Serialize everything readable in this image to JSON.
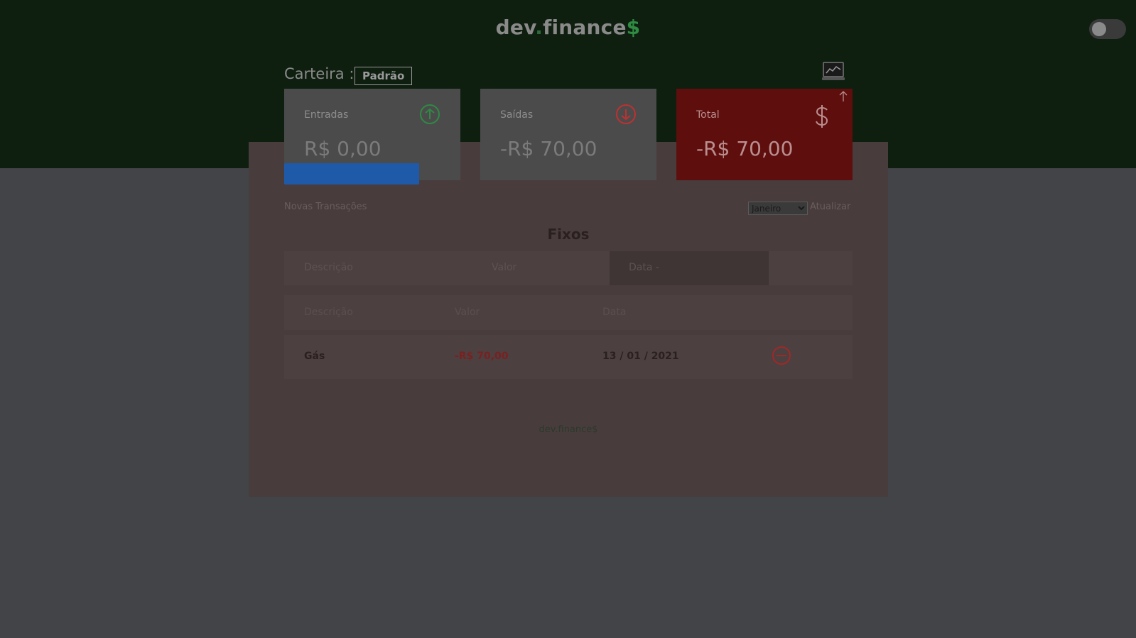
{
  "header": {
    "logo_main": "dev",
    "logo_dot": ".",
    "logo_rest": "finance",
    "logo_dollar": "$"
  },
  "wallet": {
    "label": "Carteira :",
    "name": "Padrão"
  },
  "cards": {
    "income": {
      "label": "Entradas",
      "amount": "R$ 0,00",
      "icon": "arrow-up-circle-icon"
    },
    "expense": {
      "label": "Saídas",
      "amount": "-R$ 70,00",
      "icon": "arrow-down-circle-icon"
    },
    "total": {
      "label": "Total",
      "amount": "-R$ 70,00",
      "icon": "dollar-sign-icon"
    }
  },
  "actions": {
    "new_transactions": "Novas Transações",
    "month_selected": "Janeiro",
    "update": "Atualizar"
  },
  "section_title": "Fixos",
  "form": {
    "description_placeholder": "Descrição",
    "value_placeholder": "Valor",
    "date_placeholder": "Data"
  },
  "table": {
    "headers": [
      "Descrição",
      "Valor",
      "Data"
    ],
    "rows": [
      {
        "description": "Gás",
        "value": "-R$ 70,00",
        "date": "13 / 01 / 2021"
      }
    ]
  },
  "footer": {
    "brand": "dev.finance$"
  },
  "colors": {
    "header_bg": "#0e1e0f",
    "total_card": "#5f0e0e",
    "income_icon": "#2f8a43",
    "expense_icon": "#c03030",
    "blue_bar": "#1f5aa9"
  }
}
